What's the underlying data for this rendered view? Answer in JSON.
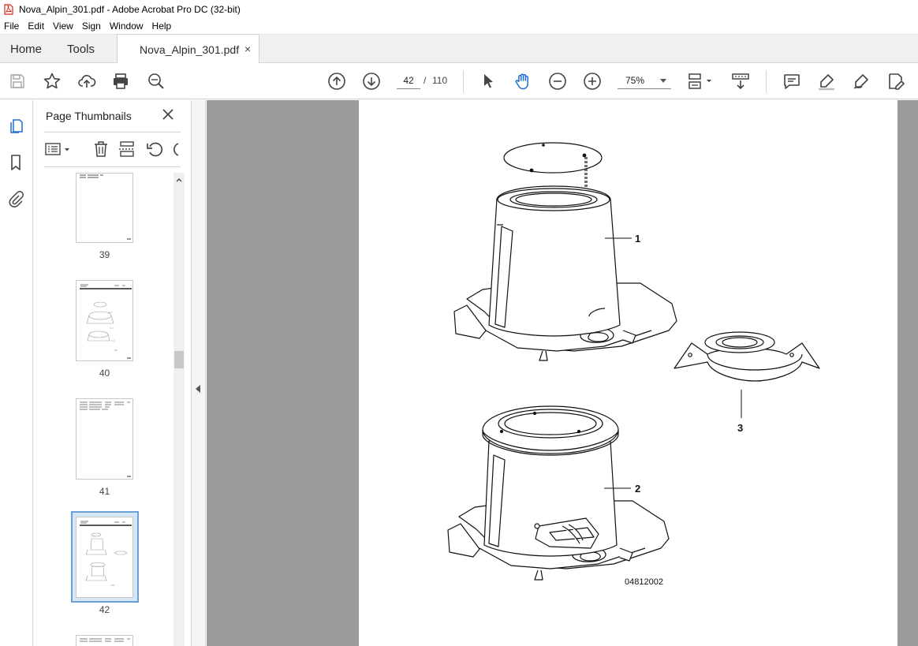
{
  "window": {
    "title": "Nova_Alpin_301.pdf - Adobe Acrobat Pro DC (32-bit)"
  },
  "menu": [
    "File",
    "Edit",
    "View",
    "Sign",
    "Window",
    "Help"
  ],
  "tabs": {
    "home": "Home",
    "tools": "Tools",
    "document": "Nova_Alpin_301.pdf",
    "close_glyph": "×"
  },
  "toolbar": {
    "page_current": "42",
    "page_separator": "/",
    "page_total": "110",
    "zoom": "75%",
    "icons": [
      "save-icon",
      "bookmark-star-icon",
      "upload-cloud-icon",
      "print-icon",
      "search-zoom-icon",
      "previous-page-icon",
      "next-page-icon",
      "select-cursor-icon",
      "hand-tool-icon",
      "zoom-out-icon",
      "zoom-in-icon",
      "fit-page-icon",
      "scroll-mode-icon",
      "comment-icon",
      "highlight-icon",
      "draw-icon",
      "fill-sign-icon"
    ]
  },
  "left_rail": {
    "icons": [
      "page-thumbnails-icon",
      "bookmarks-icon",
      "attachments-icon"
    ]
  },
  "thumbnail_panel": {
    "title": "Page Thumbnails",
    "tools": [
      "options-menu-icon",
      "delete-icon",
      "extract-icon",
      "undo-icon",
      "redo-icon"
    ],
    "thumbnails": [
      {
        "label": "39",
        "selected": false
      },
      {
        "label": "40",
        "selected": false
      },
      {
        "label": "41",
        "selected": false
      },
      {
        "label": "42",
        "selected": true
      }
    ]
  },
  "document": {
    "callouts": [
      "1",
      "2",
      "3"
    ],
    "drawing_number": "04812002"
  },
  "colors": {
    "selection_border": "#6aa0d6",
    "selection_fill": "#d7e6f5",
    "pdf_red": "#d9251c",
    "canvas_gray": "#9b9b9b"
  }
}
